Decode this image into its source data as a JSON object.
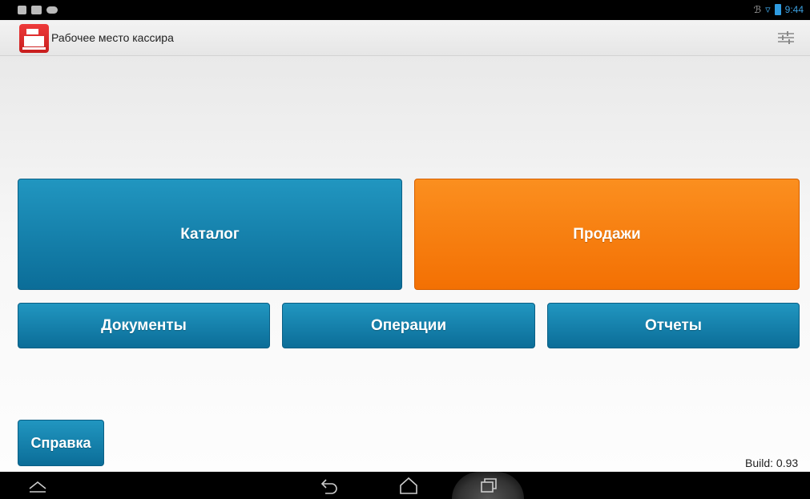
{
  "status_bar": {
    "time": "9:44",
    "icons": [
      "notification-icon",
      "sd-card-icon",
      "gamepad-icon",
      "bluetooth-icon",
      "wifi-icon",
      "battery-icon"
    ]
  },
  "action_bar": {
    "title": "Рабочее место кассира",
    "app_icon": "cash-register-icon",
    "settings_icon": "sliders-icon"
  },
  "tiles": {
    "catalog": "Каталог",
    "sales": "Продажи",
    "documents": "Документы",
    "operations": "Операции",
    "reports": "Отчеты",
    "help": "Справка"
  },
  "build": "Build: 0.93",
  "nav_bar": {
    "icons": [
      "collapse-up-icon",
      "back-icon",
      "home-icon",
      "recent-apps-icon"
    ]
  },
  "colors": {
    "tile_blue": "#1a8ab8",
    "tile_orange": "#f7800f",
    "status_accent": "#3ca0e0"
  }
}
